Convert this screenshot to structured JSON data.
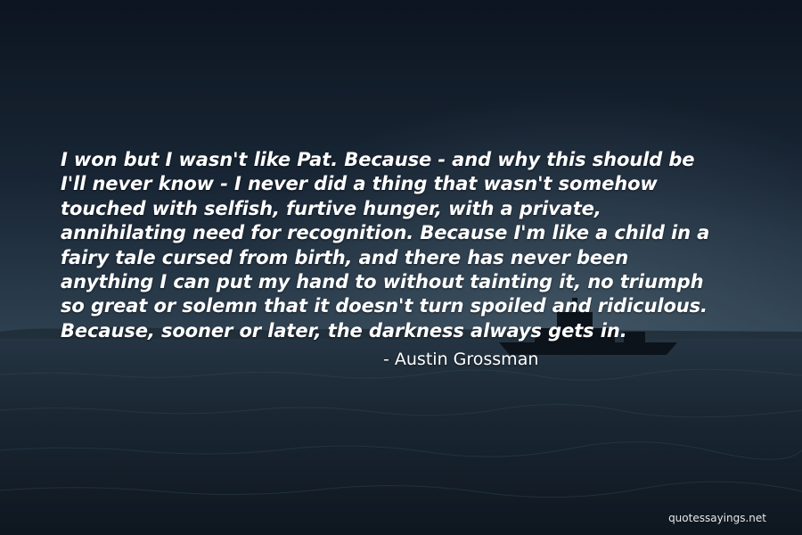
{
  "quote": {
    "lines": [
      "I won but I wasn't like Pat. Because - and why this should be",
      "I'll never know - I never did a thing that wasn't somehow",
      "touched with selfish, furtive hunger, with a private,",
      "annihilating need for recognition. Because I'm like a child in a",
      "fairy tale cursed from birth, and there has never been",
      "anything I can put my hand to without tainting it, no triumph",
      "so great or solemn that it doesn't turn spoiled and ridiculous.",
      "Because, sooner or later, the darkness always gets in."
    ],
    "author": "- Austin Grossman"
  },
  "watermark": "quotessayings.net",
  "colors": {
    "text": "#ffffff",
    "sky_top": "#101a28",
    "sky_mid": "#2c4356",
    "sea": "#1c2a38"
  }
}
